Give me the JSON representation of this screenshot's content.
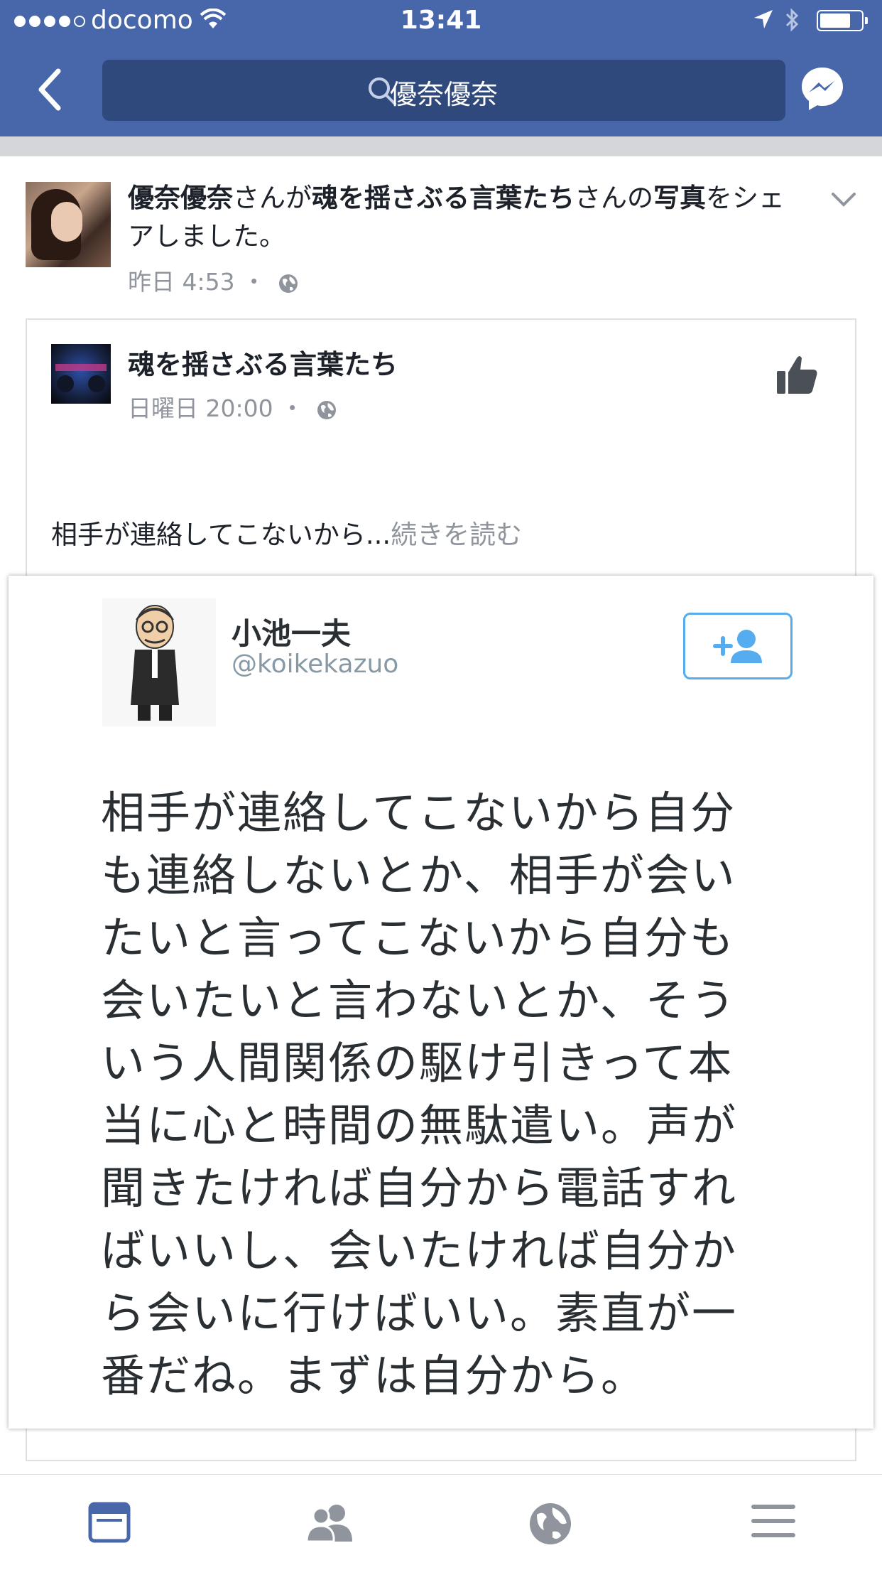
{
  "status_bar": {
    "carrier": "docomo",
    "time": "13:41",
    "battery_level": 0.75
  },
  "nav": {
    "search_text": "優奈優奈",
    "icons": [
      "back-chevron-icon",
      "search-icon",
      "messenger-icon"
    ]
  },
  "story": {
    "actor": "優奈優奈",
    "verb1": "さんが",
    "page": "魂を揺さぶる言葉たち",
    "verb2": "さんの",
    "object": "写真",
    "verb3": "をシェアしました。",
    "time": "昨日 4:53",
    "separator": "・"
  },
  "shared_post": {
    "page_name": "魂を揺さぶる言葉たち",
    "time": "日曜日 20:00",
    "excerpt": "相手が連絡してこないから...",
    "read_more": "続きを読む"
  },
  "tweet": {
    "name": "小池一夫",
    "handle": "@koikekazuo",
    "lines": [
      "相手が連絡してこないから自分",
      "も連絡しないとか、相手が会い",
      "たいと言ってこないから自分も",
      "会いたいと言わないとか、そう",
      "いう人間関係の駆け引きって本",
      "当に心と時間の無駄遣い。声が",
      "聞きたければ自分から電話すれ",
      "ばいいし、会いたければ自分か",
      "ら会いに行けばいい。素直が一",
      "番だね。まずは自分から。"
    ]
  },
  "tab_bar": {
    "tabs": [
      "news-feed-icon",
      "friends-icon",
      "notifications-globe-icon",
      "menu-icon"
    ],
    "active": "news-feed-icon"
  },
  "colors": {
    "brand": "#4867aa",
    "search_bg": "#30497d",
    "secondary_text": "#90949c",
    "twitter_blue": "#55acee"
  }
}
